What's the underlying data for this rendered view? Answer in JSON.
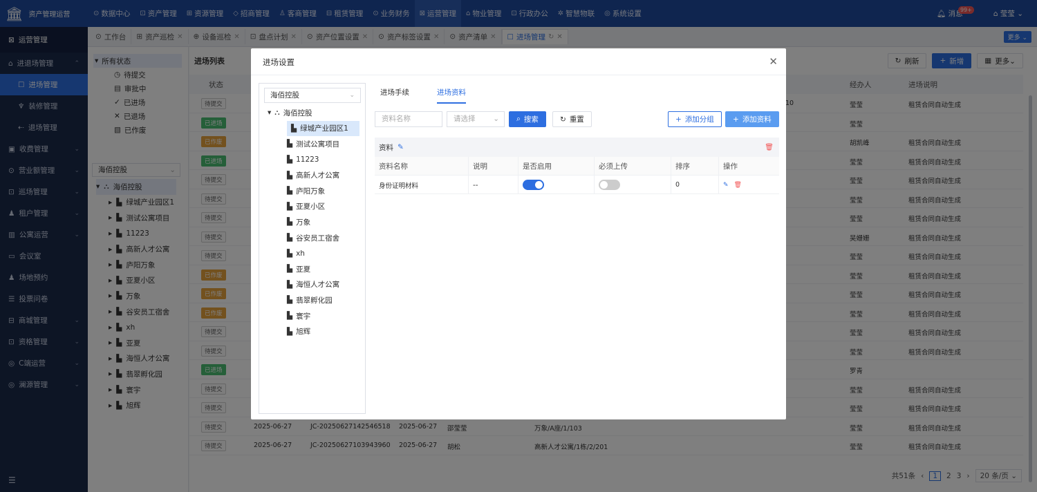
{
  "app": {
    "title": "资产管理运营"
  },
  "topnav": [
    {
      "icon": "⊙",
      "label": "数据中心"
    },
    {
      "icon": "⊡",
      "label": "资产管理"
    },
    {
      "icon": "⊞",
      "label": "资源管理"
    },
    {
      "icon": "◇",
      "label": "招商管理"
    },
    {
      "icon": "♙",
      "label": "客商管理"
    },
    {
      "icon": "⊟",
      "label": "租赁管理"
    },
    {
      "icon": "⊙",
      "label": "业务财务"
    },
    {
      "icon": "⊠",
      "label": "运营管理"
    },
    {
      "icon": "⌂",
      "label": "物业管理"
    },
    {
      "icon": "⊡",
      "label": "行政办公"
    },
    {
      "icon": "✲",
      "label": "智慧物联"
    },
    {
      "icon": "◎",
      "label": "系统设置"
    }
  ],
  "topright": {
    "messages_label": "消息",
    "badge": "99+",
    "user": "莹莹"
  },
  "sidebar": {
    "header": "运营管理",
    "items": [
      {
        "label": "进退场管理",
        "icon": "⌂",
        "arrow": "⌃",
        "type": "group"
      },
      {
        "label": "进场管理",
        "icon": "☐",
        "type": "sub",
        "selected": true
      },
      {
        "label": "装修管理",
        "icon": "♆",
        "type": "sub"
      },
      {
        "label": "退场管理",
        "icon": "⇠",
        "type": "sub"
      },
      {
        "label": "收费管理",
        "icon": "▣",
        "arrow": "⌄",
        "type": "group"
      },
      {
        "label": "营业额管理",
        "icon": "⊙",
        "arrow": "⌄",
        "type": "group"
      },
      {
        "label": "巡场管理",
        "icon": "⊡",
        "arrow": "⌄",
        "type": "group"
      },
      {
        "label": "租户管理",
        "icon": "♟",
        "arrow": "⌄",
        "type": "group"
      },
      {
        "label": "公寓运营",
        "icon": "▥",
        "arrow": "⌄",
        "type": "group"
      },
      {
        "label": "会议室",
        "icon": "▭",
        "type": "group"
      },
      {
        "label": "场地预约",
        "icon": "♟",
        "type": "group"
      },
      {
        "label": "投票问卷",
        "icon": "☰",
        "type": "group"
      },
      {
        "label": "商城管理",
        "icon": "⊟",
        "arrow": "⌄",
        "type": "group"
      },
      {
        "label": "资格管理",
        "icon": "⊡",
        "arrow": "⌄",
        "type": "group"
      },
      {
        "label": "C端运营",
        "icon": "◎",
        "arrow": "⌄",
        "type": "group"
      },
      {
        "label": "澜源管理",
        "icon": "◎",
        "arrow": "⌄",
        "type": "group"
      }
    ],
    "footer_icon": "☰"
  },
  "tabs": [
    {
      "icon": "⊙",
      "label": "工作台",
      "closable": false
    },
    {
      "icon": "⊞",
      "label": "资产巡检",
      "closable": true
    },
    {
      "icon": "⊕",
      "label": "设备巡检",
      "closable": true
    },
    {
      "icon": "⊡",
      "label": "盘点计划",
      "closable": true
    },
    {
      "icon": "⊙",
      "label": "资产位置设置",
      "closable": true
    },
    {
      "icon": "⊙",
      "label": "资产标签设置",
      "closable": true
    },
    {
      "icon": "⊙",
      "label": "资产清单",
      "closable": true
    },
    {
      "icon": "☐",
      "label": "进场管理",
      "closable": true,
      "active": true
    }
  ],
  "tab_more": "更多 ⌄",
  "status_filter": {
    "all": "所有状态",
    "items": [
      {
        "icon": "◷",
        "label": "待提交"
      },
      {
        "icon": "▤",
        "label": "审批中"
      },
      {
        "icon": "✓",
        "label": "已进场"
      },
      {
        "icon": "✕",
        "label": "已退场"
      },
      {
        "icon": "▧",
        "label": "已作废"
      }
    ]
  },
  "org_select": {
    "value": "海佰控股"
  },
  "org_tree": {
    "root": "海佰控股",
    "children": [
      "绿城产业园区1",
      "测试公寓项目",
      "11223",
      "高新人才公寓",
      "庐阳万象",
      "亚夏小区",
      "万象",
      "谷安员工宿舍",
      "xh",
      "亚夏",
      "海恒人才公寓",
      "翡翠孵化园",
      "寰宇",
      "旭辉"
    ]
  },
  "list": {
    "title": "进场列表",
    "toolbar": {
      "refresh": "刷新",
      "add": "新增",
      "more": "更多⌄"
    },
    "headers": {
      "status": "状态",
      "agent": "经办人",
      "note": "进场说明"
    },
    "rows": [
      {
        "status": "待提交",
        "kind": "pending",
        "agent": "莹莹",
        "note": "租赁合同自动生成",
        "extra": "10"
      },
      {
        "status": "已进场",
        "kind": "in",
        "agent": "莹莹",
        "note": ""
      },
      {
        "status": "已作废",
        "kind": "void",
        "agent": "胡凯峰",
        "note": "租赁合同自动生成"
      },
      {
        "status": "已进场",
        "kind": "in",
        "agent": "莹莹",
        "note": "租赁合同自动生成"
      },
      {
        "status": "待提交",
        "kind": "pending",
        "agent": "莹莹",
        "note": "租赁合同自动生成"
      },
      {
        "status": "待提交",
        "kind": "pending",
        "agent": "莹莹",
        "note": "租赁合同自动生成"
      },
      {
        "status": "待提交",
        "kind": "pending",
        "agent": "莹莹",
        "note": "租赁合同自动生成"
      },
      {
        "status": "待提交",
        "kind": "pending",
        "agent": "吴姗姗",
        "note": "租赁合同自动生成"
      },
      {
        "status": "待提交",
        "kind": "pending",
        "agent": "莹莹",
        "note": "租赁合同自动生成"
      },
      {
        "status": "已作废",
        "kind": "void",
        "agent": "莹莹",
        "note": "租赁合同自动生成"
      },
      {
        "status": "已作废",
        "kind": "void",
        "agent": "莹莹",
        "note": "租赁合同自动生成"
      },
      {
        "status": "已作废",
        "kind": "void",
        "agent": "莹莹",
        "note": "租赁合同自动生成"
      },
      {
        "status": "待提交",
        "kind": "pending",
        "agent": "莹莹",
        "note": "租赁合同自动生成"
      },
      {
        "status": "待提交",
        "kind": "pending",
        "agent": "莹莹",
        "note": "租赁合同自动生成"
      },
      {
        "status": "已进场",
        "kind": "in",
        "agent": "罗青",
        "note": ""
      },
      {
        "status": "待提交",
        "kind": "pending",
        "agent": "莹莹",
        "note": "租赁合同自动生成"
      },
      {
        "status": "待提交",
        "kind": "pending",
        "agent": "莹莹",
        "note": "租赁合同自动生成"
      },
      {
        "status": "待提交",
        "kind": "pending",
        "date1": "2025-06-27",
        "code": "JC-20250627142546518",
        "date2": "2025-06-27",
        "person": "邵莹莹",
        "location": "万象/A座/1/103",
        "agent": "莹莹",
        "note": "租赁合同自动生成"
      },
      {
        "status": "待提交",
        "kind": "pending",
        "date1": "2025-06-27",
        "code": "JC-20250627103943960",
        "date2": "2025-06-27",
        "person": "胡松",
        "location": "高新人才公寓/1栋/2/201",
        "agent": "莹莹",
        "note": "租赁合同自动生成"
      }
    ],
    "pager": {
      "total": "共51条",
      "prev": "‹",
      "pages": [
        "1",
        "2",
        "3"
      ],
      "next": "›",
      "size": "20 条/页 ⌄"
    }
  },
  "modal": {
    "title": "进场设置",
    "close": "✕",
    "select": {
      "value": "海佰控股"
    },
    "tree": {
      "root": "海佰控股",
      "selected": "绿城产业园区1",
      "children": [
        "绿城产业园区1",
        "测试公寓项目",
        "11223",
        "高新人才公寓",
        "庐阳万象",
        "亚夏小区",
        "万象",
        "谷安员工宿舍",
        "xh",
        "亚夏",
        "海恒人才公寓",
        "翡翠孵化园",
        "寰宇",
        "旭辉"
      ]
    },
    "tabs": [
      "进场手续",
      "进场资料"
    ],
    "active_tab": "进场资料",
    "filter": {
      "name_placeholder": "资料名称",
      "select_placeholder": "请选择",
      "search": "搜索",
      "reset": "重置",
      "add_group": "添加分组",
      "add_item": "添加资料"
    },
    "group": {
      "title": "资料",
      "headers": [
        "资料名称",
        "说明",
        "是否启用",
        "必须上传",
        "排序",
        "操作"
      ],
      "rows": [
        {
          "name": "身份证明材料",
          "desc": "--",
          "enabled": true,
          "required": false,
          "order": "0"
        }
      ]
    }
  },
  "colors": {
    "accent": "#2d6ee0",
    "topbar": "#1f4a9e",
    "sidebar": "#1b2a4b",
    "in": "#4bbf73",
    "void": "#e7a23c",
    "danger": "#f25656"
  }
}
